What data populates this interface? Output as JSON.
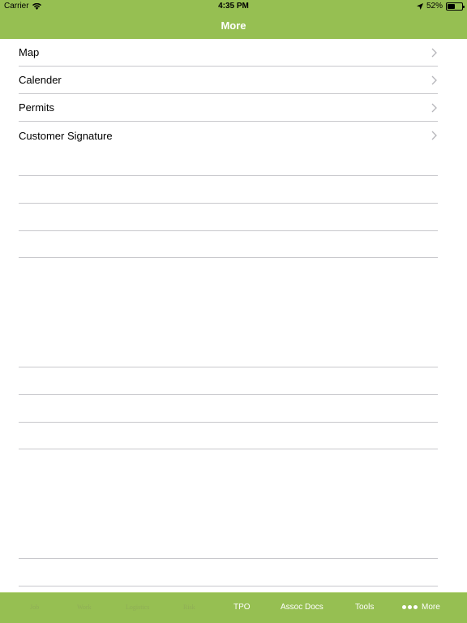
{
  "status": {
    "carrier": "Carrier",
    "time": "4:35 PM",
    "battery_percent": "52%",
    "battery_level": 0.52,
    "icons": [
      "wifi-icon",
      "location-arrow-icon",
      "battery-icon"
    ]
  },
  "nav": {
    "title": "More"
  },
  "list": {
    "items": [
      {
        "label": "Map"
      },
      {
        "label": "Calender"
      },
      {
        "label": "Permits"
      },
      {
        "label": "Customer Signature"
      }
    ]
  },
  "tabbar": {
    "tabs": [
      {
        "label": "Job"
      },
      {
        "label": "Work"
      },
      {
        "label": "Logistics"
      },
      {
        "label": "Risk"
      },
      {
        "label": "TPO"
      },
      {
        "label": "Assoc Docs"
      },
      {
        "label": "Tools"
      },
      {
        "label": "More"
      }
    ]
  },
  "colors": {
    "accent": "#96bf52",
    "separator": "#c8c8cc",
    "chevron": "#b5b5ba"
  }
}
